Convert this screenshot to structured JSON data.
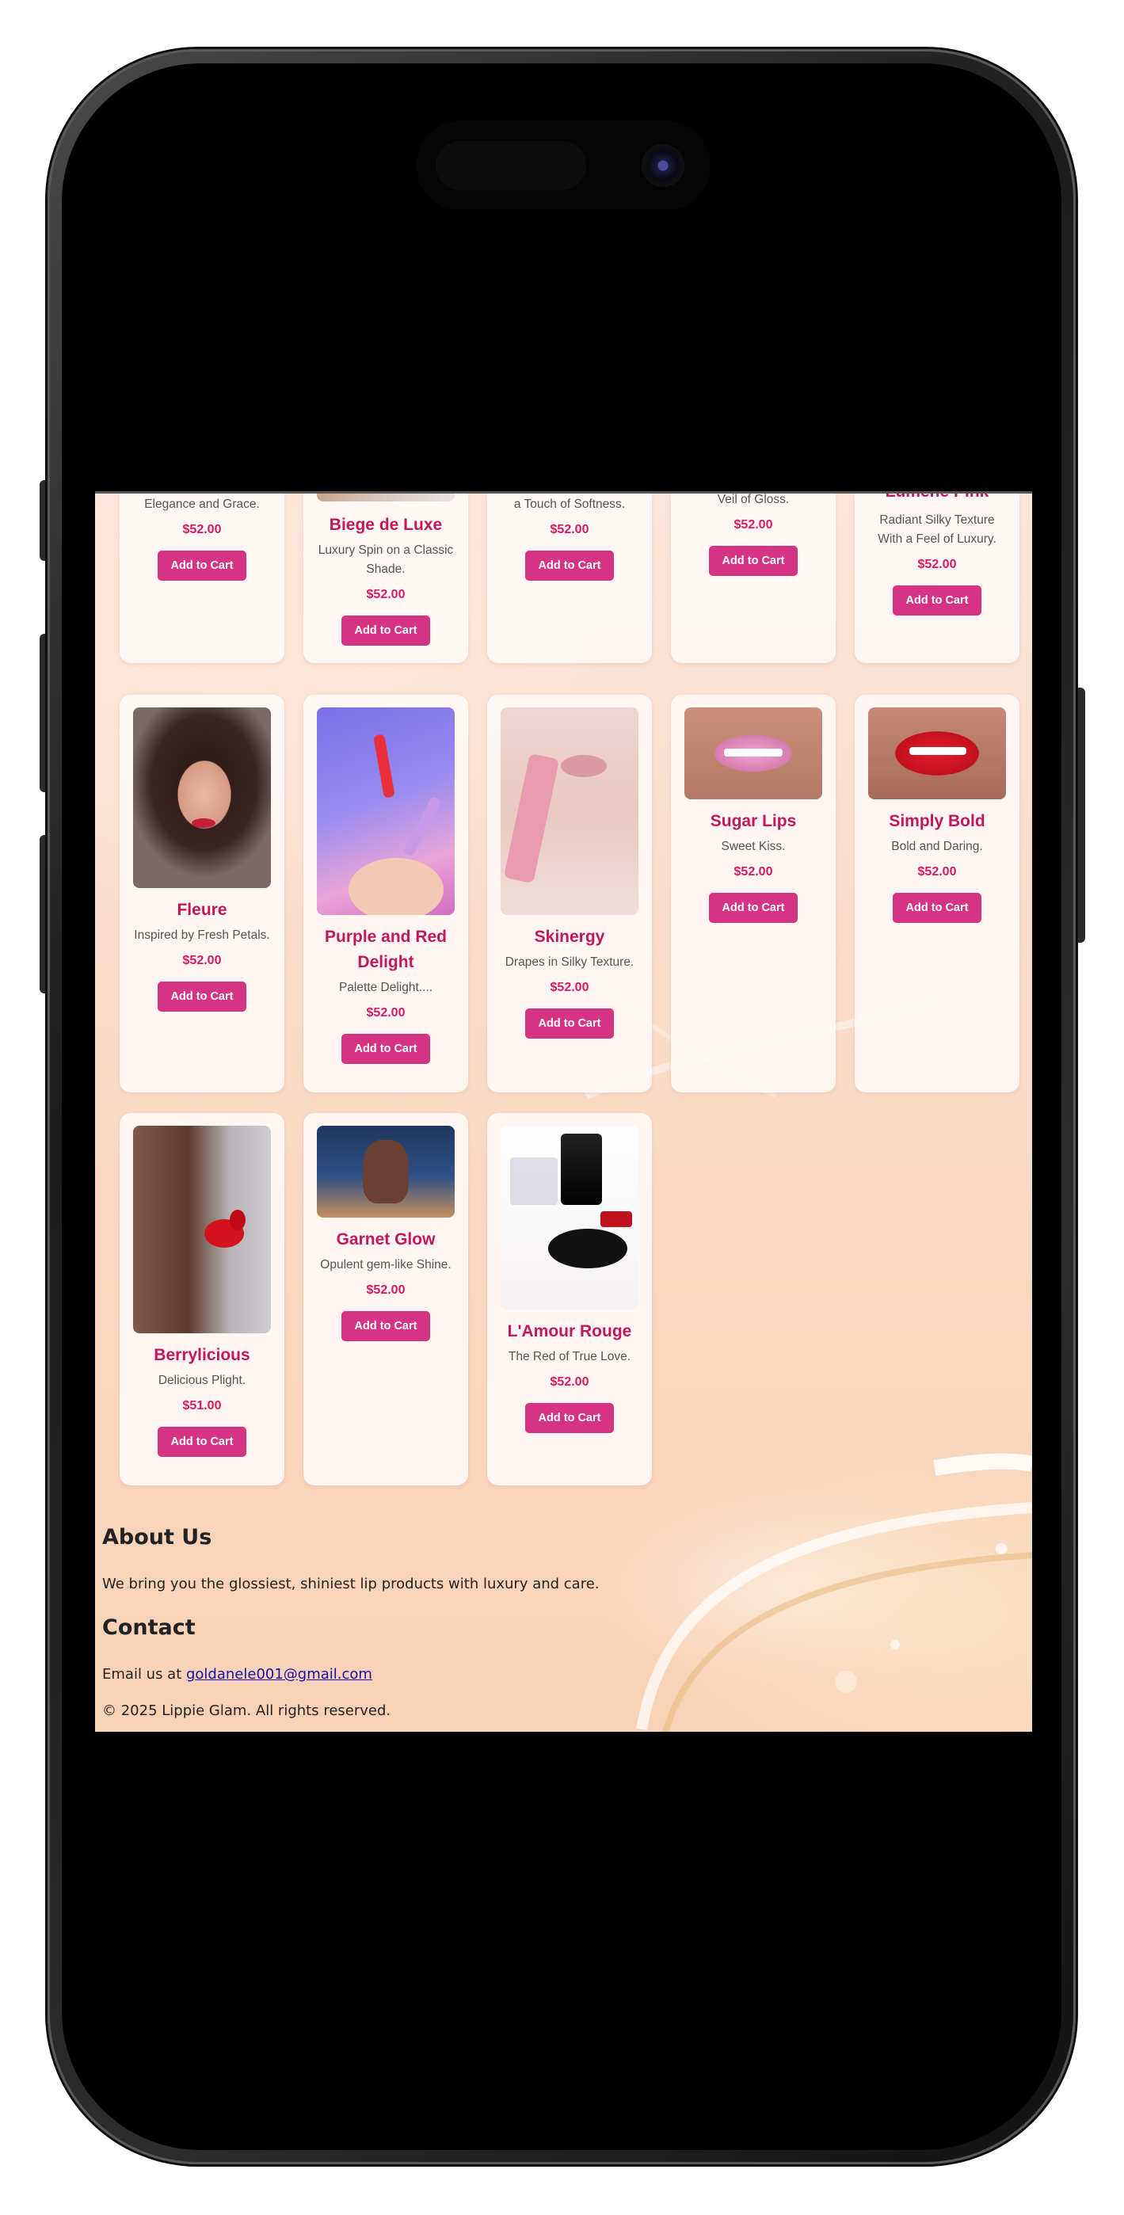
{
  "top_row": [
    {
      "desc": "Elegance and Grace.",
      "price": "$52.00",
      "button": "Add to Cart"
    },
    {
      "name": "Biege de Luxe",
      "desc": "Luxury Spin on a Classic Shade.",
      "price": "$52.00",
      "button": "Add to Cart"
    },
    {
      "desc": "a Touch of Softness.",
      "price": "$52.00",
      "button": "Add to Cart"
    },
    {
      "desc": "Veil of Gloss.",
      "price": "$52.00",
      "button": "Add to Cart"
    },
    {
      "name": "Lumene Pink",
      "desc": "Radiant Silky Texture With a Feel of Luxury.",
      "price": "$52.00",
      "button": "Add to Cart"
    }
  ],
  "middle_row": [
    {
      "name": "Fleure",
      "desc": "Inspired by Fresh Petals.",
      "price": "$52.00",
      "button": "Add to Cart"
    },
    {
      "name": "Purple and Red Delight",
      "desc": "Palette Delight....",
      "price": "$52.00",
      "button": "Add to Cart"
    },
    {
      "name": "Skinergy",
      "desc": "Drapes in Silky Texture.",
      "price": "$52.00",
      "button": "Add to Cart"
    },
    {
      "name": "Sugar Lips",
      "desc": "Sweet Kiss.",
      "price": "$52.00",
      "button": "Add to Cart"
    },
    {
      "name": "Simply Bold",
      "desc": "Bold and Daring.",
      "price": "$52.00",
      "button": "Add to Cart"
    }
  ],
  "bottom_row": [
    {
      "name": "Berrylicious",
      "desc": "Delicious Plight.",
      "price": "$51.00",
      "button": "Add to Cart"
    },
    {
      "name": "Garnet Glow",
      "desc": "Opulent gem-like Shine.",
      "price": "$52.00",
      "button": "Add to Cart"
    },
    {
      "name": "L'Amour Rouge",
      "desc": "The Red of True Love.",
      "price": "$52.00",
      "button": "Add to Cart"
    }
  ],
  "footer": {
    "about_title": "About Us",
    "about_text": "We bring you the glossiest, shiniest lip products with luxury and care.",
    "contact_title": "Contact",
    "contact_prefix": "Email us at ",
    "contact_email": "goldanele001@gmail.com",
    "copyright": "© 2025 Lippie Glam. All rights reserved."
  },
  "colors": {
    "product_name": "#c2185b",
    "price": "#d81b60",
    "button_bg": "#d63384",
    "background": "#f9d9c3"
  }
}
